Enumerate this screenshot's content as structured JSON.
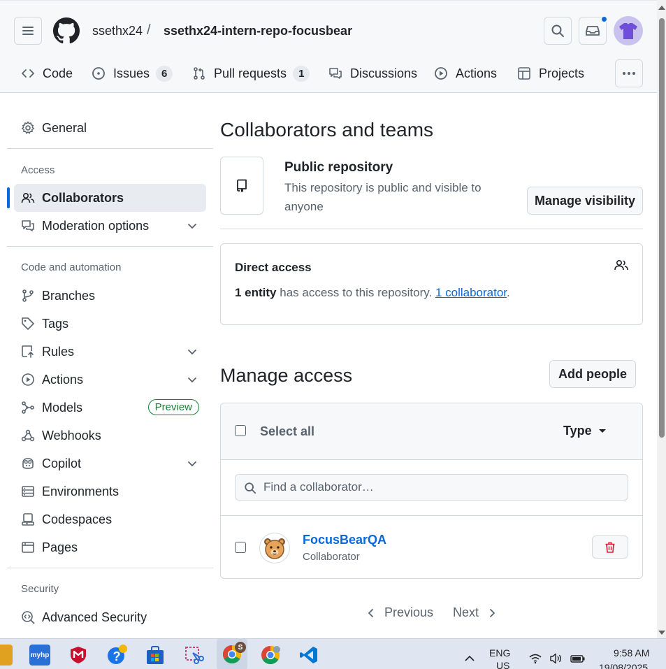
{
  "header": {
    "owner": "ssethx24",
    "separator": "/",
    "repo": "ssethx24-intern-repo-focusbear"
  },
  "tabs": [
    {
      "label": "Code"
    },
    {
      "label": "Issues",
      "count": "6"
    },
    {
      "label": "Pull requests",
      "count": "1"
    },
    {
      "label": "Discussions"
    },
    {
      "label": "Actions"
    },
    {
      "label": "Projects"
    }
  ],
  "sidebar": {
    "general": "General",
    "access_heading": "Access",
    "collaborators": "Collaborators",
    "moderation": "Moderation options",
    "code_heading": "Code and automation",
    "branches": "Branches",
    "tags": "Tags",
    "rules": "Rules",
    "actions": "Actions",
    "models": "Models",
    "preview_badge": "Preview",
    "webhooks": "Webhooks",
    "copilot": "Copilot",
    "environments": "Environments",
    "codespaces": "Codespaces",
    "pages": "Pages",
    "security_heading": "Security",
    "advanced_security": "Advanced Security"
  },
  "main": {
    "title": "Collaborators and teams",
    "visibility_title": "Public repository",
    "visibility_desc": "This repository is public and visible to anyone",
    "manage_visibility": "Manage visibility",
    "direct_access_title": "Direct access",
    "direct_entity": "1 entity",
    "direct_middle": " has access to this repository. ",
    "direct_link": "1 collaborator",
    "direct_end": ".",
    "manage_access_title": "Manage access",
    "add_people": "Add people",
    "select_all": "Select all",
    "type_filter": "Type",
    "search_placeholder": "Find a collaborator…",
    "members": [
      {
        "name": "FocusBearQA",
        "role": "Collaborator"
      }
    ],
    "pager_previous": "Previous",
    "pager_next": "Next"
  },
  "taskbar": {
    "lang_top": "ENG",
    "lang_bottom": "US",
    "time": "9:58 AM",
    "date": "19/08/2025",
    "hp_label": "myhp",
    "chrome_badge": "S"
  },
  "colors": {
    "accent": "#0969da",
    "danger": "#cf222e",
    "success": "#1a7f37"
  }
}
